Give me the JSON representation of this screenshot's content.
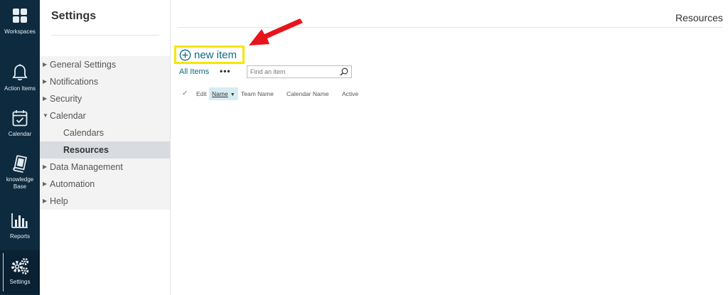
{
  "rail": [
    {
      "label": "Workspaces",
      "icon": "grid-icon"
    },
    {
      "label": "Action Items",
      "icon": "bell-icon"
    },
    {
      "label": "Calendar",
      "icon": "calendar-icon"
    },
    {
      "label": "knowledge Base",
      "icon": "book-icon"
    },
    {
      "label": "Reports",
      "icon": "bar-chart-icon"
    },
    {
      "label": "Settings",
      "icon": "gears-icon",
      "active": true
    }
  ],
  "nav": {
    "title": "Settings",
    "items": [
      {
        "label": "General Settings"
      },
      {
        "label": "Notifications"
      },
      {
        "label": "Security"
      },
      {
        "label": "Calendar",
        "expanded": true
      },
      {
        "label": "Calendars",
        "sub": true
      },
      {
        "label": "Resources",
        "sub": true,
        "selected": true
      },
      {
        "label": "Data Management"
      },
      {
        "label": "Automation"
      },
      {
        "label": "Help"
      }
    ]
  },
  "main": {
    "page_title": "Resources",
    "new_item_label": "new item",
    "view_label": "All Items",
    "more_label": "•••",
    "search": {
      "placeholder": "Find an item",
      "value": ""
    },
    "columns": {
      "check": "✓",
      "edit": "Edit",
      "name": "Name",
      "team_name": "Team Name",
      "calendar_name": "Calendar Name",
      "active": "Active"
    }
  },
  "colors": {
    "rail_bg": "#0d2a3f",
    "accent": "#0f6b86",
    "highlight_box": "#f5e600",
    "arrow": "#e8141c"
  }
}
